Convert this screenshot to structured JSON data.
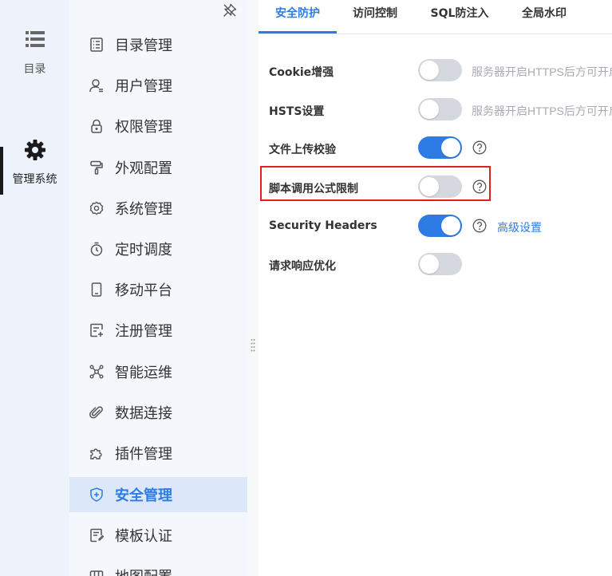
{
  "rail": {
    "items": [
      {
        "label": "目录",
        "icon": "list-icon"
      },
      {
        "label": "管理系统",
        "icon": "gear-icon",
        "active": true
      }
    ]
  },
  "menu": {
    "items": [
      {
        "label": "目录管理",
        "icon": "catalog-icon"
      },
      {
        "label": "用户管理",
        "icon": "user-icon"
      },
      {
        "label": "权限管理",
        "icon": "lock-icon"
      },
      {
        "label": "外观配置",
        "icon": "paint-roller-icon"
      },
      {
        "label": "系统管理",
        "icon": "settings-icon"
      },
      {
        "label": "定时调度",
        "icon": "timer-icon"
      },
      {
        "label": "移动平台",
        "icon": "mobile-icon"
      },
      {
        "label": "注册管理",
        "icon": "register-icon"
      },
      {
        "label": "智能运维",
        "icon": "network-icon"
      },
      {
        "label": "数据连接",
        "icon": "paperclip-icon"
      },
      {
        "label": "插件管理",
        "icon": "puzzle-icon"
      },
      {
        "label": "安全管理",
        "icon": "shield-icon",
        "active": true
      },
      {
        "label": "模板认证",
        "icon": "template-icon"
      },
      {
        "label": "地图配置",
        "icon": "map-icon"
      }
    ]
  },
  "tabs": [
    {
      "label": "安全防护",
      "active": true
    },
    {
      "label": "访问控制"
    },
    {
      "label": "SQL防注入"
    },
    {
      "label": "全局水印"
    }
  ],
  "settings": [
    {
      "label": "Cookie增强",
      "on": false,
      "hint": "服务器开启HTTPS后方可开启"
    },
    {
      "label": "HSTS设置",
      "on": false,
      "hint": "服务器开启HTTPS后方可开启"
    },
    {
      "label": "文件上传校验",
      "on": true,
      "help": true
    },
    {
      "label": "脚本调用公式限制",
      "on": false,
      "help": true,
      "highlighted": true
    },
    {
      "label": "Security Headers",
      "on": true,
      "help": true,
      "link": "高级设置"
    },
    {
      "label": "请求响应优化",
      "on": false
    }
  ],
  "colors": {
    "accent": "#2d7be5",
    "highlight": "#e02020",
    "switch_off": "#d5d8de"
  }
}
